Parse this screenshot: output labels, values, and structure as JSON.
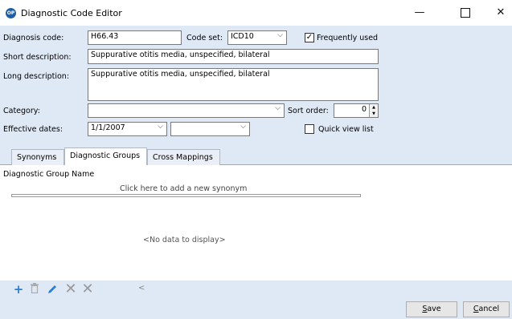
{
  "window": {
    "title": "Diagnostic Code Editor",
    "app_icon_text": "OP",
    "minimize_glyph": "—",
    "close_glyph": "✕"
  },
  "form": {
    "diagnosis_code_label": "Diagnosis code:",
    "diagnosis_code_value": "H66.43",
    "code_set_label": "Code set:",
    "code_set_value": "ICD10",
    "frequently_used_label": "Frequently used",
    "frequently_used_checked": true,
    "short_desc_label": "Short description:",
    "short_desc_value": "Suppurative otitis media, unspecified, bilateral",
    "long_desc_label": "Long description:",
    "long_desc_value": "Suppurative otitis media, unspecified, bilateral",
    "category_label": "Category:",
    "category_value": "",
    "sort_order_label": "Sort order:",
    "sort_order_value": "0",
    "effective_dates_label": "Effective dates:",
    "effective_start": "1/1/2007",
    "effective_end": "",
    "quick_view_label": "Quick view list",
    "quick_view_checked": false
  },
  "tabs": [
    {
      "label": "Synonyms"
    },
    {
      "label": "Diagnostic Groups"
    },
    {
      "label": "Cross Mappings"
    }
  ],
  "grid": {
    "column_header": "Diagnostic Group Name",
    "new_row_text": "Click here to add a new synonym",
    "empty_text": "<No data to display>"
  },
  "toolbar": {
    "add_icon": "plus-icon",
    "delete_icon": "trash-icon",
    "edit_icon": "pencil-icon",
    "cancel_icon": "x-icon",
    "clear_icon": "x-icon",
    "scroll_left_glyph": "<"
  },
  "footer": {
    "save_label": "Save",
    "cancel_label": "Cancel"
  }
}
